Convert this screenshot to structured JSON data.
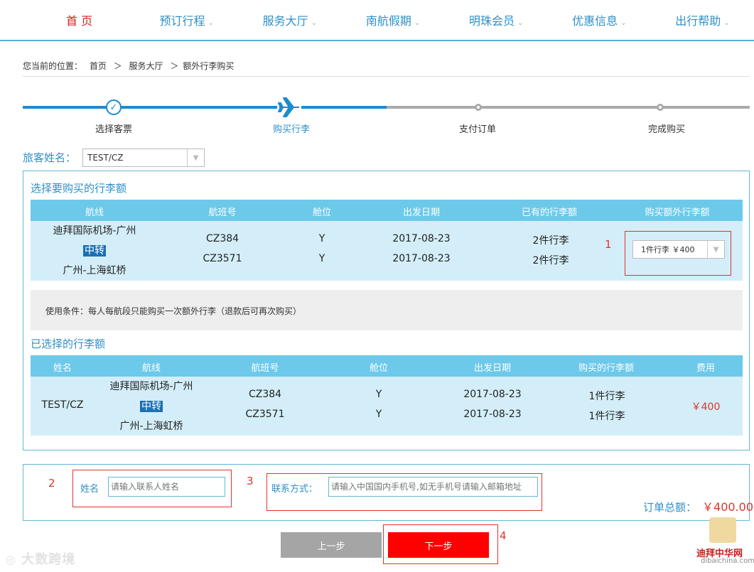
{
  "nav": {
    "items": [
      {
        "label": "首 页",
        "active": true,
        "chevron": false
      },
      {
        "label": "预订行程",
        "chevron": true
      },
      {
        "label": "服务大厅",
        "chevron": true
      },
      {
        "label": "南航假期",
        "chevron": true
      },
      {
        "label": "明珠会员",
        "chevron": true
      },
      {
        "label": "优惠信息",
        "chevron": true
      },
      {
        "label": "出行帮助",
        "chevron": true
      }
    ],
    "chevron_glyph": "⌄"
  },
  "breadcrumb": {
    "prefix": "您当前的位置：",
    "home": "首页",
    "sep1": "＞",
    "hall": "服务大厅",
    "sep2": "＞",
    "current": "额外行李购买"
  },
  "steps": [
    {
      "label": "选择客票",
      "state": "done"
    },
    {
      "label": "购买行李",
      "state": "current"
    },
    {
      "label": "支付订单",
      "state": "todo"
    },
    {
      "label": "完成购买",
      "state": "todo"
    }
  ],
  "passenger": {
    "label": "旅客姓名：",
    "value": "TEST/CZ"
  },
  "select_section": {
    "title": "选择要购买的行李额",
    "headers": [
      "航线",
      "航班号",
      "舱位",
      "出发日期",
      "已有的行李额",
      "购买额外行李额"
    ],
    "route": {
      "line1": "迪拜国际机场-广州",
      "transfer": "中转",
      "line2": "广州-上海虹桥"
    },
    "flights": [
      "CZ384",
      "CZ3571"
    ],
    "cabins": [
      "Y",
      "Y"
    ],
    "dates": [
      "2017-08-23",
      "2017-08-23"
    ],
    "existing": [
      "2件行李",
      "2件行李"
    ],
    "purchase_select": "1件行李 ￥400"
  },
  "condition": "使用条件：每人每航段只能购买一次额外行李（退款后可再次购买）",
  "selected_section": {
    "title": "已选择的行李额",
    "headers": [
      "姓名",
      "航线",
      "航班号",
      "舱位",
      "出发日期",
      "购买的行李额",
      "费用"
    ],
    "name": "TEST/CZ",
    "route": {
      "line1": "迪拜国际机场-广州",
      "transfer": "中转",
      "line2": "广州-上海虹桥"
    },
    "flights": [
      "CZ384",
      "CZ3571"
    ],
    "cabins": [
      "Y",
      "Y"
    ],
    "dates": [
      "2017-08-23",
      "2017-08-23"
    ],
    "bought": [
      "1件行李",
      "1件行李"
    ],
    "fee": "￥400"
  },
  "contact": {
    "name_label": "姓名",
    "name_placeholder": "请输入联系人姓名",
    "method_label": "联系方式：",
    "method_placeholder": "请输入中国国内手机号,如无手机号请输入邮箱地址"
  },
  "total": {
    "label": "订单总额：",
    "value": "￥400.00"
  },
  "buttons": {
    "prev": "上一步",
    "next": "下一步"
  },
  "annotations": {
    "n1": "1",
    "n2": "2",
    "n3": "3",
    "n4": "4"
  },
  "watermarks": {
    "left": "大数跨境",
    "right_cn": "迪拜中华网",
    "right_en": "dibaichina.com"
  },
  "colors": {
    "accent": "#2f8fc6",
    "header_bg": "#6cc9ea",
    "row_bg": "#d3eef8",
    "red": "#ff0000",
    "active_nav": "#d9201a"
  }
}
